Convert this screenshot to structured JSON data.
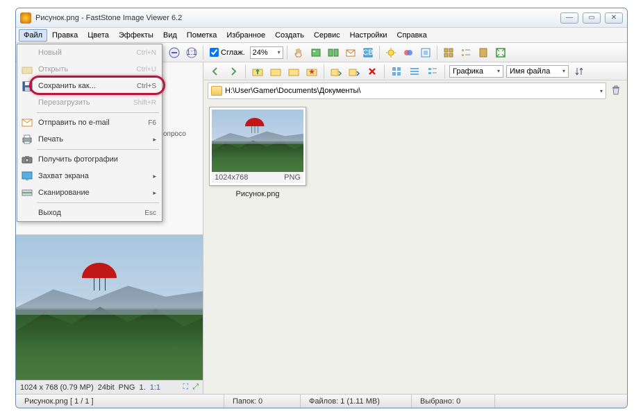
{
  "title": "Рисунок.png  -  FastStone Image Viewer 6.2",
  "menubar": [
    "Файл",
    "Правка",
    "Цвета",
    "Эффекты",
    "Вид",
    "Пометка",
    "Избранное",
    "Создать",
    "Сервис",
    "Настройки",
    "Справка"
  ],
  "toolbar": {
    "smooth_label": "Сглаж.",
    "zoom_value": "24%"
  },
  "nav": {
    "sort1": "Графика",
    "sort2": "Имя файла"
  },
  "path": "H:\\User\\Gamer\\Documents\\Документы\\",
  "thumb": {
    "dims": "1024x768",
    "fmt": "PNG",
    "name": "Рисунок.png"
  },
  "preview_info": {
    "dims": "1024 x 768 (0.79 MP)",
    "bit": "24bit",
    "fmt": "PNG",
    "page": "1.",
    "ratio": "1:1"
  },
  "status": {
    "file": "Рисунок.png [ 1 / 1 ]",
    "folders": "Папок: 0",
    "files": "Файлов: 1 (1.11 MB)",
    "selected": "Выбрано: 0"
  },
  "file_menu": {
    "new": {
      "label": "Новый",
      "shortcut": "Ctrl+N"
    },
    "open": {
      "label": "Открыть",
      "shortcut": "Ctrl+U"
    },
    "saveas": {
      "label": "Сохранить как...",
      "shortcut": "Ctrl+S"
    },
    "reload": {
      "label": "Перезагрузить",
      "shortcut": "Shift+R"
    },
    "email": {
      "label": "Отправить по e-mail",
      "shortcut": "F6"
    },
    "print": {
      "label": "Печать"
    },
    "acquire": {
      "label": "Получить фотографии"
    },
    "capture": {
      "label": "Захват экрана"
    },
    "scan": {
      "label": "Сканирование"
    },
    "exit": {
      "label": "Выход",
      "shortcut": "Esc"
    }
  },
  "fragment": "опросо"
}
